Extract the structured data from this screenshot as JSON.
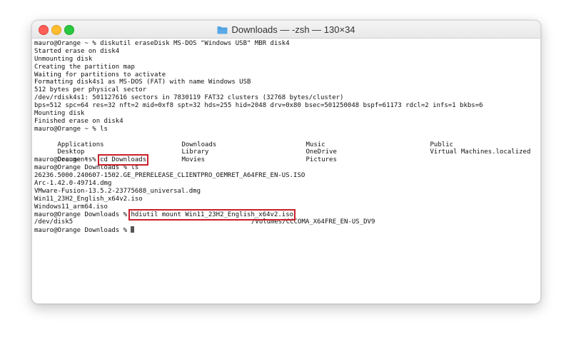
{
  "window": {
    "title": "Downloads — -zsh — 130×34"
  },
  "icons": {
    "title_folder": "folder-icon",
    "cursor": "block-cursor"
  },
  "colors": {
    "highlight_box": "#c8202a",
    "folder": "#5aa9e6"
  },
  "terminal": {
    "lines1": [
      "mauro@Orange ~ % diskutil eraseDisk MS-DOS \"Windows USB\" MBR disk4",
      "Started erase on disk4",
      "Unmounting disk",
      "Creating the partition map",
      "Waiting for partitions to activate",
      "Formatting disk4s1 as MS-DOS (FAT) with name Windows USB",
      "512 bytes per physical sector",
      "/dev/rdisk4s1: 501127616 sectors in 7830119 FAT32 clusters (32768 bytes/cluster)",
      "bps=512 spc=64 res=32 nft=2 mid=0xf8 spt=32 hds=255 hid=2048 drv=0x80 bsec=501250048 bspf=61173 rdcl=2 infs=1 bkbs=6",
      "Mounting disk",
      "Finished erase on disk4",
      "mauro@Orange ~ % ls"
    ],
    "ls_rows": [
      [
        "Applications",
        "Downloads",
        "Music",
        "Public"
      ],
      [
        "Desktop",
        "Library",
        "OneDrive",
        "Virtual Machines.localized"
      ]
    ],
    "ls_row3": {
      "c1": "Documents",
      "c2": "Movies",
      "c3": "Pictures"
    },
    "cd_prompt": "mauro@Orange ~ % ",
    "cd_command": "cd Downloads",
    "lines2": [
      "mauro@Orange Downloads % ls",
      "26236.5000.240607-1502.GE_PRERELEASE_CLIENTPRO_OEMRET_A64FRE_EN-US.ISO",
      "Arc-1.42.0-49714.dmg",
      "VMware-Fusion-13.5.2-23775688_universal.dmg",
      "Win11_23H2_English_x64v2.iso",
      "Windows11_arm64.iso"
    ],
    "mount_prompt": "mauro@Orange Downloads % ",
    "mount_command": "hdiutil mount Win11_23H2_English_x64v2.iso",
    "disk_dev": "/dev/disk5",
    "disk_volume": "/Volumes/CCCOMA_X64FRE_EN-US_DV9",
    "final_prompt": "mauro@Orange Downloads % "
  }
}
